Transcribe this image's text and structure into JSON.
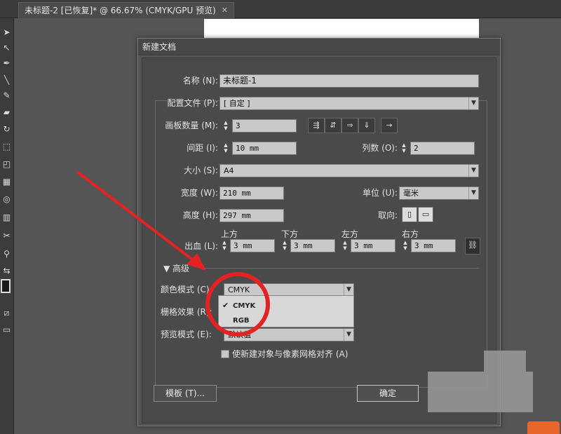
{
  "tab": {
    "title": "未标题-2 [已恢复]* @ 66.67% (CMYK/GPU 预览)",
    "close": "✕"
  },
  "dialog": {
    "title": "新建文档",
    "name_label": "名称 (N):",
    "name_value": "未标题-1",
    "profile_label": "配置文件 (P):",
    "profile_value": "[ 自定 ]",
    "artboards_label": "画板数量 (M):",
    "artboards_value": "3",
    "spacing_label": "间距 (I):",
    "spacing_value": "10 mm",
    "columns_label": "列数 (O):",
    "columns_value": "2",
    "size_label": "大小 (S):",
    "size_value": "A4",
    "width_label": "宽度 (W):",
    "width_value": "210 mm",
    "units_label": "单位 (U):",
    "units_value": "毫米",
    "height_label": "高度 (H):",
    "height_value": "297 mm",
    "orientation_label": "取向:",
    "bleed_label": "出血 (L):",
    "bleed_top_label": "上方",
    "bleed_bottom_label": "下方",
    "bleed_left_label": "左方",
    "bleed_right_label": "右方",
    "bleed_top": "3 mm",
    "bleed_bottom": "3 mm",
    "bleed_left": "3 mm",
    "bleed_right": "3 mm",
    "advanced_label": "高级",
    "color_mode_label": "颜色模式 (C):",
    "color_mode_value": "CMYK",
    "color_mode_options": [
      "CMYK",
      "RGB"
    ],
    "raster_label": "栅格效果 (R):",
    "preview_label": "预览模式 (E):",
    "preview_value": "默认值",
    "align_pixel_label": "使新建对象与像素网格对齐 (A)",
    "templates_button": "模板 (T)...",
    "ok_button": "确定"
  },
  "colors": {
    "annotation_red": "#e32323",
    "dialog_bg": "#4a4a4a"
  }
}
